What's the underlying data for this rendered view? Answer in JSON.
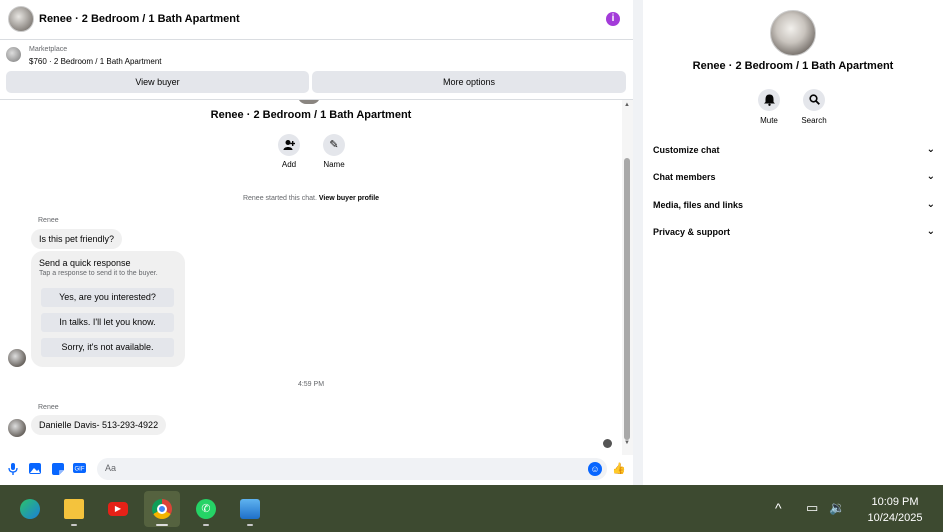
{
  "header": {
    "title": "Renee · 2 Bedroom / 1 Bath Apartment"
  },
  "marketplace": {
    "label": "Marketplace",
    "listing": "$760 · 2 Bedroom / 1 Bath Apartment",
    "view_buyer": "View buyer",
    "more_options": "More options"
  },
  "conversation": {
    "title": "Renee · 2 Bedroom / 1 Bath Apartment",
    "add_label": "Add",
    "name_label": "Name",
    "started_text": "Renee started this chat.",
    "view_profile": "View buyer profile",
    "sender": "Renee",
    "message1": "Is this pet friendly?",
    "quick_title": "Send a quick response",
    "quick_sub": "Tap a response to send it to the buyer.",
    "quick_options": [
      "Yes, are you interested?",
      "In talks. I'll let you know.",
      "Sorry, it's not available."
    ],
    "time": "4:59 PM",
    "message2": "Danielle Davis- 513-293-4922"
  },
  "composer": {
    "placeholder": "Aa"
  },
  "info_panel": {
    "name": "Renee · 2 Bedroom / 1 Bath Apartment",
    "mute": "Mute",
    "search": "Search",
    "sections": [
      "Customize chat",
      "Chat members",
      "Media, files and links",
      "Privacy & support"
    ]
  },
  "taskbar": {
    "time": "10:09 PM",
    "date": "10/24/2025"
  },
  "colors": {
    "accent": "#0866ff",
    "info_icon": "#a33bd9",
    "taskbar": "#3d4a30"
  }
}
